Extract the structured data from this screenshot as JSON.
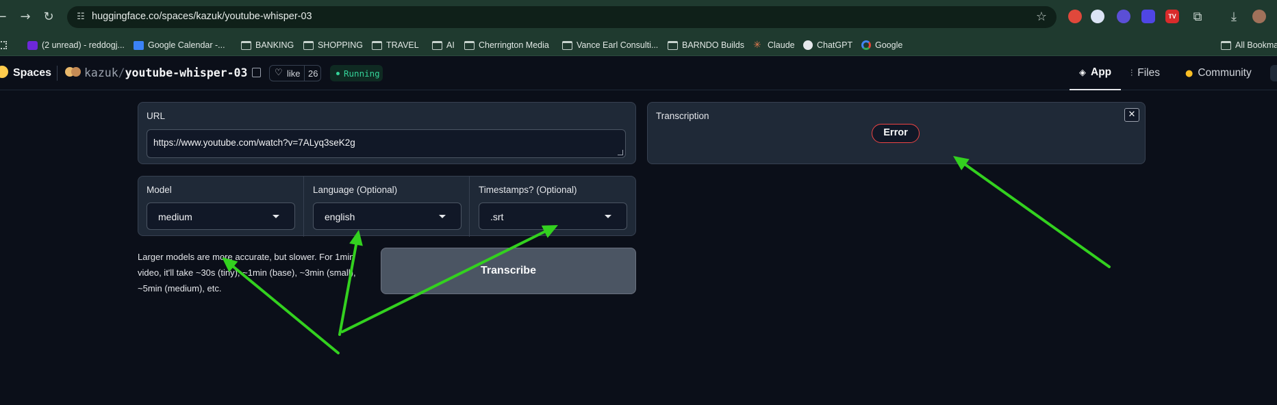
{
  "browser": {
    "url": "huggingface.co/spaces/kazuk/youtube-whisper-03",
    "bookmarks": [
      {
        "label": "(2 unread) - reddogj...",
        "icon": "yahoo-mail-icon"
      },
      {
        "label": "Google Calendar -...",
        "icon": "calendar-icon"
      },
      {
        "label": "BANKING",
        "icon": "folder-icon"
      },
      {
        "label": "SHOPPING",
        "icon": "folder-icon"
      },
      {
        "label": "TRAVEL",
        "icon": "folder-icon"
      },
      {
        "label": "AI",
        "icon": "folder-icon"
      },
      {
        "label": "Cherrington Media",
        "icon": "folder-icon"
      },
      {
        "label": "Vance Earl Consulti...",
        "icon": "folder-icon"
      },
      {
        "label": "BARNDO Builds",
        "icon": "folder-icon"
      },
      {
        "label": "Claude",
        "icon": "claude-icon"
      },
      {
        "label": "ChatGPT",
        "icon": "chatgpt-icon"
      },
      {
        "label": "Google",
        "icon": "google-icon"
      }
    ],
    "all_bookmarks": "All Bookma",
    "colors": {
      "chrome": "#1f3a2f",
      "omnibox": "#0f2019"
    }
  },
  "header": {
    "spaces_label": "Spaces",
    "owner": "kazuk",
    "separator": "/",
    "repo_name": "youtube-whisper-03",
    "like_label": "like",
    "like_count": "26",
    "status": "Running",
    "tabs": [
      {
        "label": "App",
        "icon": "cube-icon",
        "active": true
      },
      {
        "label": "Files",
        "icon": "files-icon",
        "active": false
      },
      {
        "label": "Community",
        "icon": "community-icon",
        "active": false
      }
    ]
  },
  "app": {
    "url_label": "URL",
    "url_value": "https://www.youtube.com/watch?v=7ALyq3seK2g",
    "model_label": "Model",
    "model_value": "medium",
    "language_label": "Language (Optional)",
    "language_value": "english",
    "timestamps_label": "Timestamps? (Optional)",
    "timestamps_value": ".srt",
    "info_text": "Larger models are more accurate, but slower. For 1min video, it'll take ~30s (tiny), ~1min (base), ~3min (small), ~5min (medium), etc.",
    "transcribe_label": "Transcribe",
    "transcription_label": "Transcription",
    "error_label": "Error",
    "close_glyph": "✕"
  },
  "annotations": {
    "arrow_color": "#33d11f",
    "count": 4
  },
  "colors": {
    "page_bg": "#0b0f19",
    "panel_bg": "#1f2937",
    "error_border": "#ef4444",
    "running": "#34d399"
  }
}
